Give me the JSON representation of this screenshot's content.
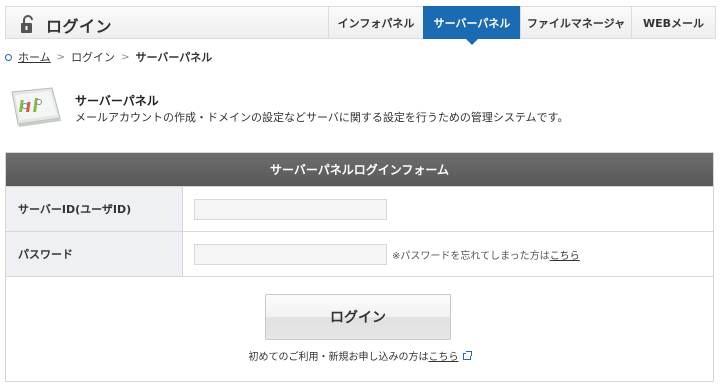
{
  "header": {
    "title": "ログイン",
    "icon": "lock-icon",
    "tabs": [
      {
        "label": "インフォパネル",
        "active": false
      },
      {
        "label": "サーバーパネル",
        "active": true
      },
      {
        "label": "ファイルマネージャ",
        "active": false
      },
      {
        "label": "WEBメール",
        "active": false
      }
    ]
  },
  "breadcrumb": {
    "items": [
      "ホーム",
      "ログイン",
      "サーバーパネル"
    ]
  },
  "intro": {
    "title": "サーバーパネル",
    "description": "メールアカウントの作成・ドメインの設定などサーバに関する設定を行うための管理システムです。"
  },
  "form": {
    "heading": "サーバーパネルログインフォーム",
    "server_id_label": "サーバーID(ユーザID)",
    "server_id_value": "",
    "password_label": "パスワード",
    "password_value": "",
    "forgot_text": "※パスワードを忘れてしまった方は",
    "forgot_link": "こちら",
    "login_button": "ログイン",
    "signup_text": "初めてのご利用・新規お申し込みの方は",
    "signup_link": "こちら"
  },
  "colors": {
    "accent": "#1b6bb3",
    "form_header": "#606060",
    "label_bg": "#eef0f4"
  }
}
